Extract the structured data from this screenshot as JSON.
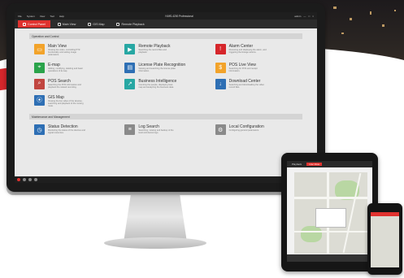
{
  "window": {
    "app_title": "iVMS-4200 Professional",
    "menu": [
      "File",
      "System",
      "View",
      "Tool",
      "Help"
    ],
    "controls": [
      "admin",
      "—",
      "□",
      "×"
    ]
  },
  "tabs": [
    {
      "label": "Control Panel",
      "icon": "home-icon",
      "active": true
    },
    {
      "label": "Main View",
      "icon": "monitor-icon",
      "active": false
    },
    {
      "label": "GIS Map",
      "icon": "map-icon",
      "active": false
    },
    {
      "label": "Remote Playback",
      "icon": "film-icon",
      "active": false
    }
  ],
  "sections": [
    {
      "header": "Operation and Control",
      "modules": [
        {
          "name": "Main View",
          "desc": "Viewing live video, controlling PTZ functionality and setting image parameters.",
          "color": "#f2a32a",
          "icon": "monitor-icon"
        },
        {
          "name": "Remote Playback",
          "desc": "Searching the record files and playback.",
          "color": "#27a7a3",
          "icon": "film-icon"
        },
        {
          "name": "Alarm Center",
          "desc": "Receiving and displaying the alarm, and triggering the linkage actions.",
          "color": "#d6262b",
          "icon": "bell-icon"
        },
        {
          "name": "E-map",
          "desc": "Adding, modifying, deleting and basic operations of E-map.",
          "color": "#2aa34a",
          "icon": "map-icon"
        },
        {
          "name": "License Plate Recognition",
          "desc": "Viewing and searching the license plate information.",
          "color": "#2e6fb4",
          "icon": "plate-icon"
        },
        {
          "name": "POS Live View",
          "desc": "Searching for POS and receipt information.",
          "color": "#f2a32a",
          "icon": "pos-icon"
        },
        {
          "name": "POS Search",
          "desc": "Searching the POS information and playback the related recording.",
          "color": "#c1453f",
          "icon": "search-icon"
        },
        {
          "name": "Business Intelligence",
          "desc": "Counting the people, displaying heat map and analyzing the business data.",
          "color": "#27a7a3",
          "icon": "chart-icon"
        },
        {
          "name": "Download Center",
          "desc": "Searching and downloading the video record files.",
          "color": "#2e6fb4",
          "icon": "download-icon"
        },
        {
          "name": "GIS Map",
          "desc": "Viewing the live video of the devices, searching and playback of the moving route.",
          "color": "#2e6fb4",
          "icon": "pin-icon"
        }
      ]
    },
    {
      "header": "Maintenance and Management",
      "modules": [
        {
          "name": "Status Detection",
          "desc": "Monitoring the status of the devices and signal resources.",
          "color": "#2e6fb4",
          "icon": "clock-icon"
        },
        {
          "name": "Log Search",
          "desc": "Searching, viewing and backup of the local and device logs.",
          "color": "#8a8a8a",
          "icon": "log-icon"
        },
        {
          "name": "Local Configuration",
          "desc": "Configuring general parameters.",
          "color": "#8a8a8a",
          "icon": "gear-icon"
        }
      ]
    }
  ],
  "tablet": {
    "tabs": [
      "Playback",
      "Live View"
    ]
  }
}
